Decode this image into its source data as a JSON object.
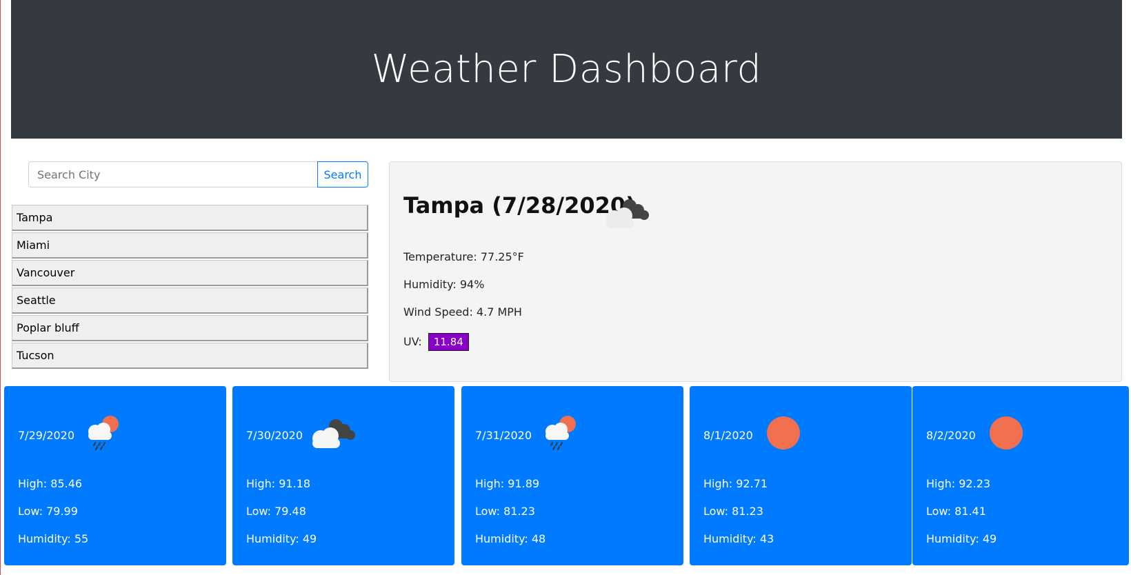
{
  "header": {
    "title": "Weather Dashboard"
  },
  "search": {
    "placeholder": "Search City",
    "button_label": "Search"
  },
  "history": [
    {
      "label": "Tampa"
    },
    {
      "label": "Miami"
    },
    {
      "label": "Vancouver"
    },
    {
      "label": "Seattle"
    },
    {
      "label": "Poplar bluff"
    },
    {
      "label": "Tucson"
    }
  ],
  "current": {
    "title": "Tampa (7/28/2020)",
    "icon": "broken-clouds-icon",
    "temperature": "Temperature: 77.25°F",
    "humidity": "Humidity: 94%",
    "wind": "Wind Speed: 4.7 MPH",
    "uv_label": "UV:",
    "uv_value": "11.84",
    "uv_color": "#8b00c9"
  },
  "forecast": [
    {
      "date": "7/29/2020",
      "icon": "rain-sun-icon",
      "high": "High: 85.46",
      "low": "Low: 79.99",
      "humidity": "Humidity: 55"
    },
    {
      "date": "7/30/2020",
      "icon": "broken-clouds-icon",
      "high": "High: 91.18",
      "low": "Low: 79.48",
      "humidity": "Humidity: 49"
    },
    {
      "date": "7/31/2020",
      "icon": "rain-sun-icon",
      "high": "High: 91.89",
      "low": "Low: 81.23",
      "humidity": "Humidity: 48"
    },
    {
      "date": "8/1/2020",
      "icon": "sun-icon",
      "high": "High: 92.71",
      "low": "Low: 81.23",
      "humidity": "Humidity: 43"
    },
    {
      "date": "8/2/2020",
      "icon": "sun-icon",
      "high": "High: 92.23",
      "low": "Low: 81.41",
      "humidity": "Humidity: 49"
    }
  ],
  "colors": {
    "header_bg": "#343a40",
    "accent": "#007bff",
    "sun": "#f0704f"
  }
}
